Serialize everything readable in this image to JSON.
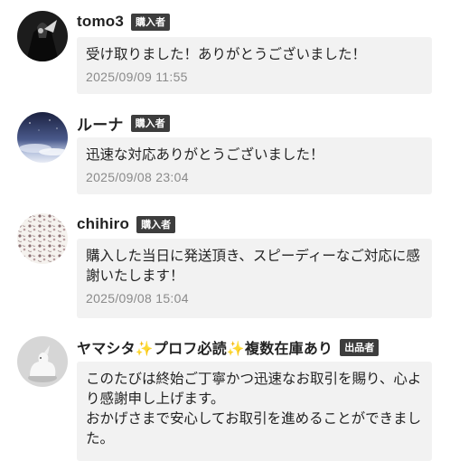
{
  "comments": [
    {
      "username": "tomo3",
      "badge": "購入者",
      "message": "受け取りました！ありがとうございました！",
      "timestamp": "2025/09/09 11:55",
      "avatar": "dark-figure-photo"
    },
    {
      "username": "ルーナ",
      "badge": "購入者",
      "message": "迅速な対応ありがとうございました！",
      "timestamp": "2025/09/08 23:04",
      "avatar": "night-sky-photo"
    },
    {
      "username": "chihiro",
      "badge": "購入者",
      "message": "購入した当日に発送頂き、スピーディーなご対応に感謝いたします！",
      "timestamp": "2025/09/08 15:04",
      "avatar": "floral-pattern"
    },
    {
      "username": "ヤマシタ✨プロフ必読✨複数在庫あり",
      "badge": "出品者",
      "message": "このたびは終始ご丁寧かつ迅速なお取引を賜り、心より感謝申し上げます。\nおかげさまで安心してお取引を進めることができました。",
      "avatar": "white-figurine-photo"
    }
  ],
  "colors": {
    "badge_bg": "#3d3d3d",
    "bubble_bg": "#f2f2f2",
    "timestamp": "#8a8a8a"
  }
}
